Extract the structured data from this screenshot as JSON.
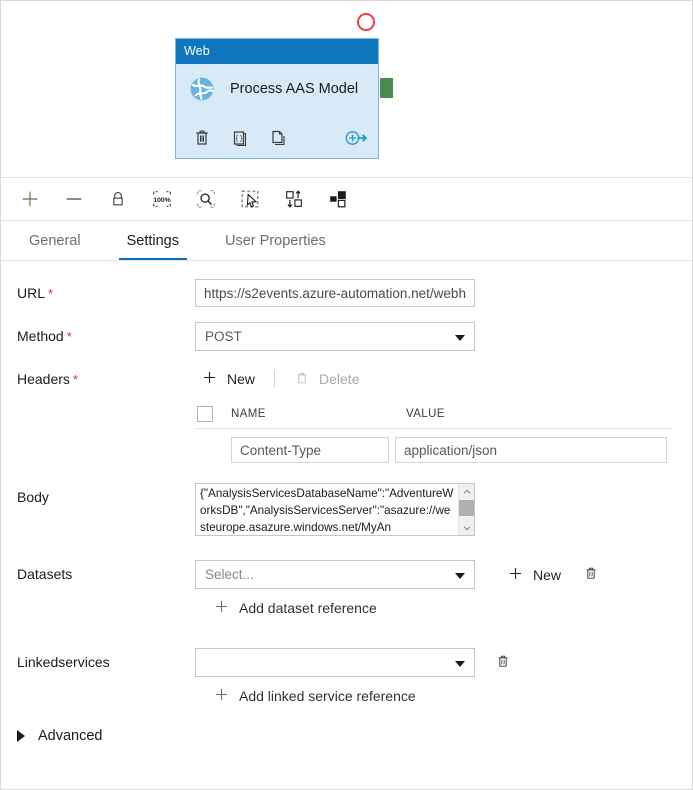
{
  "canvas": {
    "activity": {
      "type_label": "Web",
      "name": "Process AAS Model",
      "icon": "web-globe-icon",
      "header_color": "#0f75bc",
      "body_color": "#d8e9f7",
      "border_color": "#7ab6e0",
      "actions": [
        {
          "name": "delete-activity-icon",
          "title": "Delete"
        },
        {
          "name": "code-view-icon",
          "title": "Code"
        },
        {
          "name": "clone-activity-icon",
          "title": "Clone"
        },
        {
          "name": "add-output-icon",
          "title": "Add output"
        }
      ],
      "breakpoint_color": "#ef4042",
      "connector_color": "#4a8a4e"
    }
  },
  "toolbar": {
    "buttons": [
      {
        "name": "zoom-in-icon",
        "title": "Zoom in"
      },
      {
        "name": "zoom-out-icon",
        "title": "Zoom out"
      },
      {
        "name": "lock-icon",
        "title": "Lock"
      },
      {
        "name": "zoom-to-100-percent-icon",
        "title": "100%",
        "label": "100%"
      },
      {
        "name": "zoom-to-fit-icon",
        "title": "Zoom to fit"
      },
      {
        "name": "select-mode-icon",
        "title": "Select"
      },
      {
        "name": "auto-align-icon",
        "title": "Auto align"
      },
      {
        "name": "layout-icon",
        "title": "Layout"
      }
    ]
  },
  "tabs": [
    {
      "label": "General",
      "active": false
    },
    {
      "label": "Settings",
      "active": true
    },
    {
      "label": "User Properties",
      "active": false
    }
  ],
  "settings": {
    "url": {
      "label": "URL",
      "required": true,
      "value": "https://s2events.azure-automation.net/webh",
      "placeholder": ""
    },
    "method": {
      "label": "Method",
      "required": true,
      "value": "POST"
    },
    "headers": {
      "label": "Headers",
      "required": true,
      "new_label": "New",
      "delete_label": "Delete",
      "columns": [
        "NAME",
        "VALUE"
      ],
      "rows": [
        {
          "name": "Content-Type",
          "value": "application/json"
        }
      ]
    },
    "body": {
      "label": "Body",
      "required": false,
      "value": "{\"AnalysisServicesDatabaseName\":\"AdventureWorksDB\",\"AnalysisServicesServer\":\"asazure://westeurope.asazure.windows.net/MyAn"
    },
    "datasets": {
      "label": "Datasets",
      "selected": "Select...",
      "is_placeholder": true,
      "new_label": "New",
      "delete_icon": "trash-icon",
      "add_reference_label": "Add dataset reference"
    },
    "linkedservices": {
      "label": "Linkedservices",
      "selected": "",
      "is_placeholder": true,
      "delete_icon": "trash-icon",
      "add_reference_label": "Add linked service reference"
    },
    "advanced": {
      "label": "Advanced",
      "expanded": false
    }
  }
}
